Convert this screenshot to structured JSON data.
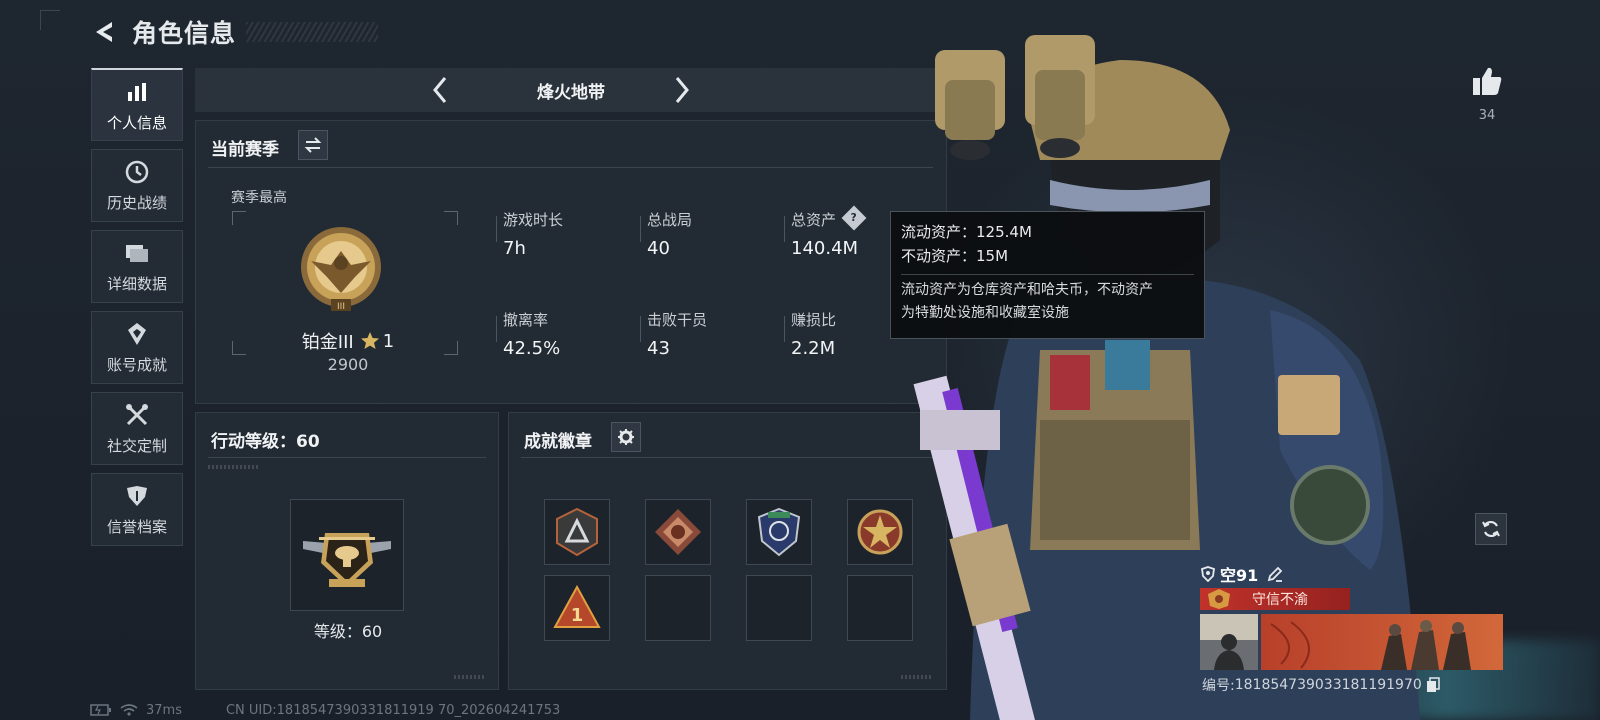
{
  "header": {
    "title": "角色信息"
  },
  "sidebar": {
    "items": [
      {
        "label": "个人信息",
        "active": true
      },
      {
        "label": "历史战绩"
      },
      {
        "label": "详细数据"
      },
      {
        "label": "账号成就"
      },
      {
        "label": "社交定制"
      },
      {
        "label": "信誉档案"
      }
    ]
  },
  "mode": {
    "title": "烽火地带"
  },
  "season": {
    "title": "当前赛季",
    "best_label": "赛季最高",
    "rank_name": "铂金III",
    "rank_stars": "1",
    "rank_points": "2900",
    "stats": [
      {
        "label": "游戏时长",
        "value": "7h"
      },
      {
        "label": "总战局",
        "value": "40"
      },
      {
        "label": "总资产",
        "value": "140.4M"
      },
      {
        "label": "撤离率",
        "value": "42.5%"
      },
      {
        "label": "击败干员",
        "value": "43"
      },
      {
        "label": "赚损比",
        "value": "2.2M"
      }
    ]
  },
  "tooltip": {
    "liquid_label": "流动资产：",
    "liquid_value": "125.4M",
    "fixed_label": "不动资产：",
    "fixed_value": "15M",
    "desc_line1": "流动资产为仓库资产和哈夫币，不动资产",
    "desc_line2": "为特勤处设施和收藏室设施"
  },
  "action_level": {
    "title": "行动等级：60",
    "level_text": "等级：60"
  },
  "badges": {
    "title": "成就徽章"
  },
  "profile": {
    "likes": "34",
    "player_name": "空91",
    "title_text": "守信不渝",
    "id_label": "编号:",
    "id_value": "1818547390331811919",
    "id_suffix": "70"
  },
  "status": {
    "ping": "37ms",
    "uid_text": "CN UID:1818547390331811919 70_202604241753"
  },
  "colors": {
    "accent_red": "#c8322a",
    "panel_bg": "#222a33",
    "gold": "#c9a25a"
  }
}
